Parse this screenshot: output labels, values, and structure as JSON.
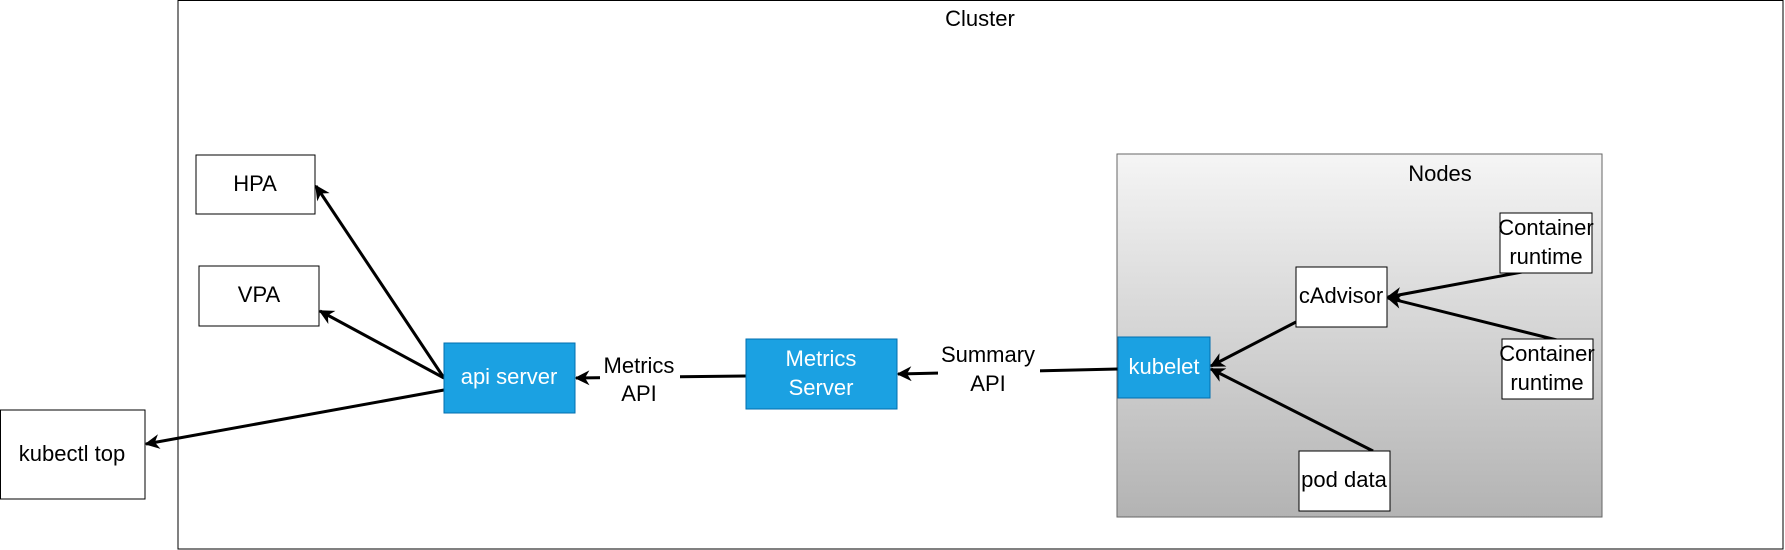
{
  "cluster": {
    "title": "Cluster"
  },
  "nodes_group": {
    "title": "Nodes"
  },
  "boxes": {
    "hpa": "HPA",
    "vpa": "VPA",
    "kubectl_top": "kubectl top",
    "api_server": "api server",
    "metrics_server": [
      "Metrics",
      "Server"
    ],
    "kubelet": "kubelet",
    "cadvisor": "cAdvisor",
    "container_runtime_1": [
      "Container",
      "runtime"
    ],
    "container_runtime_2": [
      "Container",
      "runtime"
    ],
    "pod_data": "pod data"
  },
  "edge_labels": {
    "metrics_api": [
      "Metrics",
      "API"
    ],
    "summary_api": [
      "Summary",
      "API"
    ]
  },
  "colors": {
    "accent_box": "#1ba1e2",
    "accent_border": "#006eaf",
    "nodes_gradient_top": "#f5f5f5",
    "nodes_gradient_bottom": "#b3b3b3"
  }
}
